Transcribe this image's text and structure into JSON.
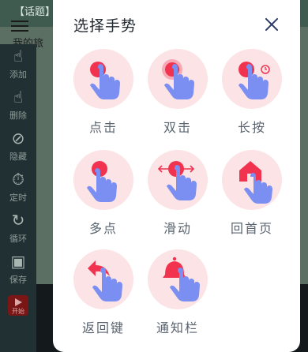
{
  "background": {
    "topic_text": "【话题】",
    "subtitle_text": "我的旅",
    "sidebar": [
      {
        "label": "添加",
        "glyph": "☝"
      },
      {
        "label": "删除",
        "glyph": "☝"
      },
      {
        "label": "隐藏",
        "glyph": "⊘"
      },
      {
        "label": "定时",
        "glyph": "⏱"
      },
      {
        "label": "循环",
        "glyph": "↻"
      },
      {
        "label": "保存",
        "glyph": "▣"
      }
    ],
    "start_label": "开始"
  },
  "modal": {
    "title": "选择手势",
    "close_icon": "close-icon",
    "gestures": [
      {
        "label": "点击",
        "icon": "tap-icon"
      },
      {
        "label": "双击",
        "icon": "double-tap-icon"
      },
      {
        "label": "长按",
        "icon": "long-press-icon"
      },
      {
        "label": "多点",
        "icon": "multi-touch-icon"
      },
      {
        "label": "滑动",
        "icon": "swipe-icon"
      },
      {
        "label": "回首页",
        "icon": "home-icon"
      },
      {
        "label": "返回键",
        "icon": "back-icon"
      },
      {
        "label": "通知栏",
        "icon": "notification-icon"
      }
    ]
  },
  "colors": {
    "accent_red": "#f2334f",
    "circle_bg": "#fbe3e6",
    "hand_blue": "#7b8ef2",
    "title_text": "#222a30",
    "label_text": "#5a6470"
  }
}
